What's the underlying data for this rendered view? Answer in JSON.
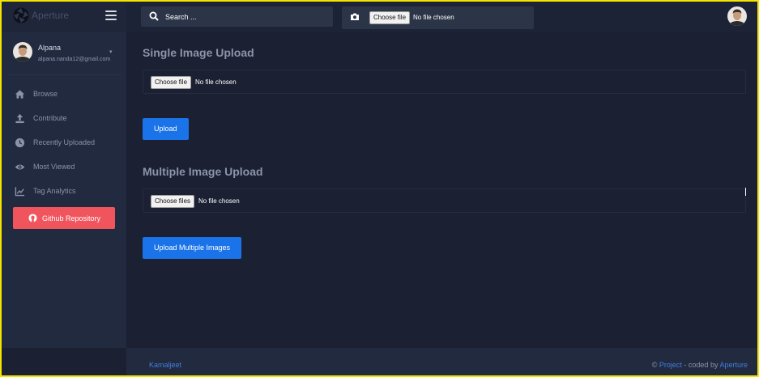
{
  "brand": {
    "name": "Aperture",
    "logo_icon": "aperture-icon"
  },
  "sidebar": {
    "profile": {
      "name": "Alpana",
      "email": "alpana.nanda12@gmail.com"
    },
    "items": [
      {
        "label": "Browse",
        "icon": "home-icon"
      },
      {
        "label": "Contribute",
        "icon": "upload-icon"
      },
      {
        "label": "Recently Uploaded",
        "icon": "clock-icon"
      },
      {
        "label": "Most Viewed",
        "icon": "eye-icon"
      },
      {
        "label": "Tag Analytics",
        "icon": "chart-line-icon"
      }
    ],
    "github_button": {
      "label": "Github Repository",
      "icon": "github-icon",
      "color": "#f0555e"
    }
  },
  "topbar": {
    "search": {
      "placeholder": "Search ..."
    },
    "camera_upload": {
      "button": "Choose file",
      "status": "No file chosen"
    }
  },
  "main": {
    "single": {
      "title": "Single Image Upload",
      "file_button": "Choose file",
      "file_status": "No file chosen",
      "submit": "Upload"
    },
    "multiple": {
      "title": "Multiple Image Upload",
      "file_button": "Choose files",
      "file_status": "No file chosen",
      "submit": "Upload Multiple Images"
    }
  },
  "footer": {
    "left": "Kamaljeet",
    "copyright": "©",
    "project": "Project",
    "coded_by": "- coded by",
    "author": "Aperture"
  },
  "colors": {
    "accent": "#1a73e8",
    "background": "#1b2033",
    "sidebar": "#222a3f",
    "link": "#3f7fe0"
  }
}
